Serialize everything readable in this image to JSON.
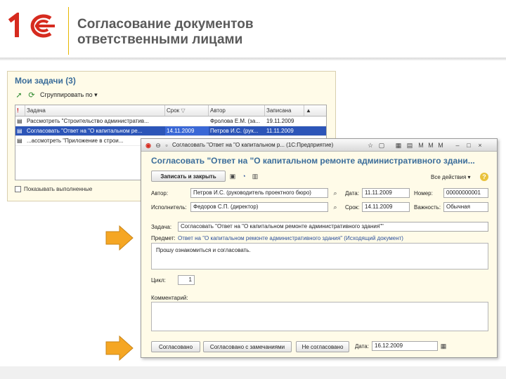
{
  "slide": {
    "logo_text": "1С",
    "title_line1": "Согласование документов",
    "title_line2": "ответственными лицами"
  },
  "tasks_window": {
    "title": "Мои задачи (3)",
    "group_by_label": "Сгруппировать по",
    "columns": [
      "Задача",
      "Срок",
      "Автор",
      "Записана"
    ],
    "rows": [
      {
        "task": "Рассмотреть \"Строительство административ...",
        "deadline": "",
        "author": "Фролова Е.М. (за...",
        "date": "19.11.2009"
      },
      {
        "task": "Согласовать \"Ответ на \"О капитальном ре...",
        "deadline": "14.11.2009",
        "author": "Петров И.С. (рук...",
        "date": "11.11.2009"
      },
      {
        "task": "...ассмотреть \"Приложение в строи...",
        "deadline": "",
        "author": "",
        "date": ""
      }
    ],
    "show_completed_label": "Показывать выполненные"
  },
  "doc_window": {
    "titlebar_text": "Согласовать \"Ответ на \"О капитальном р... (1С:Предприятие)",
    "heading": "Согласовать \"Ответ на \"О капитальном ремонте административного здани...",
    "save_close_button": "Записать и закрыть",
    "all_actions": "Все действия",
    "help_icon": "?",
    "author_label": "Автор:",
    "author_value": "Петров И.С. (руководитель проектного бюро)",
    "executor_label": "Исполнитель:",
    "executor_value": "Федоров С.П. (директор)",
    "date_label": "Дата:",
    "date_value": "11.11.2009",
    "deadline_label": "Срок:",
    "deadline_value": "14.11.2009",
    "number_label": "Номер:",
    "number_value": "00000000001",
    "importance_label": "Важность:",
    "importance_value": "Обычная",
    "task_label": "Задача:",
    "task_value": "Согласовать \"Ответ на \"О капитальном ремонте административного здания\"\"",
    "subject_label": "Предмет:",
    "subject_value": "Ответ на \"О капитальном ремонте административного здания\" (Исходящий документ)",
    "description": "Прошу ознакомиться и согласовать.",
    "cycle_label": "Цикл:",
    "cycle_value": "1",
    "comment_label": "Комментарий:",
    "approve_button": "Согласовано",
    "approve_with_remarks_button": "Согласовано с замечаниями",
    "reject_button": "Не согласовано",
    "bottom_date_label": "Дата:",
    "bottom_date_value": "16.12.2009"
  },
  "colors": {
    "heading_blue": "#3b6d9a",
    "window_bg": "#fffbe8",
    "arrow_orange": "#f5a623",
    "logo_red": "#d62b1f"
  }
}
